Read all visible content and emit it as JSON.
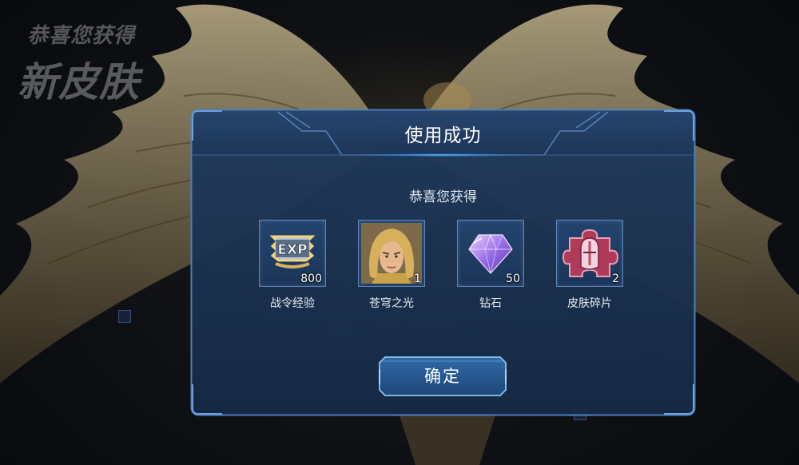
{
  "banner": {
    "small": "恭喜您获得",
    "big": "新皮肤"
  },
  "dialog": {
    "title": "使用成功",
    "subtitle": "恭喜您获得",
    "rewards": [
      {
        "name": "战令经验",
        "count": "800",
        "icon": "exp-badge-icon"
      },
      {
        "name": "苍穹之光",
        "count": "1",
        "icon": "hero-portrait"
      },
      {
        "name": "钻石",
        "count": "50",
        "icon": "diamond-icon"
      },
      {
        "name": "皮肤碎片",
        "count": "2",
        "icon": "skin-fragment-icon"
      }
    ],
    "confirm_label": "确定"
  },
  "colors": {
    "panel": "#1a3050",
    "border": "#4f7fb8",
    "accent_glow": "#5ac8ff"
  }
}
